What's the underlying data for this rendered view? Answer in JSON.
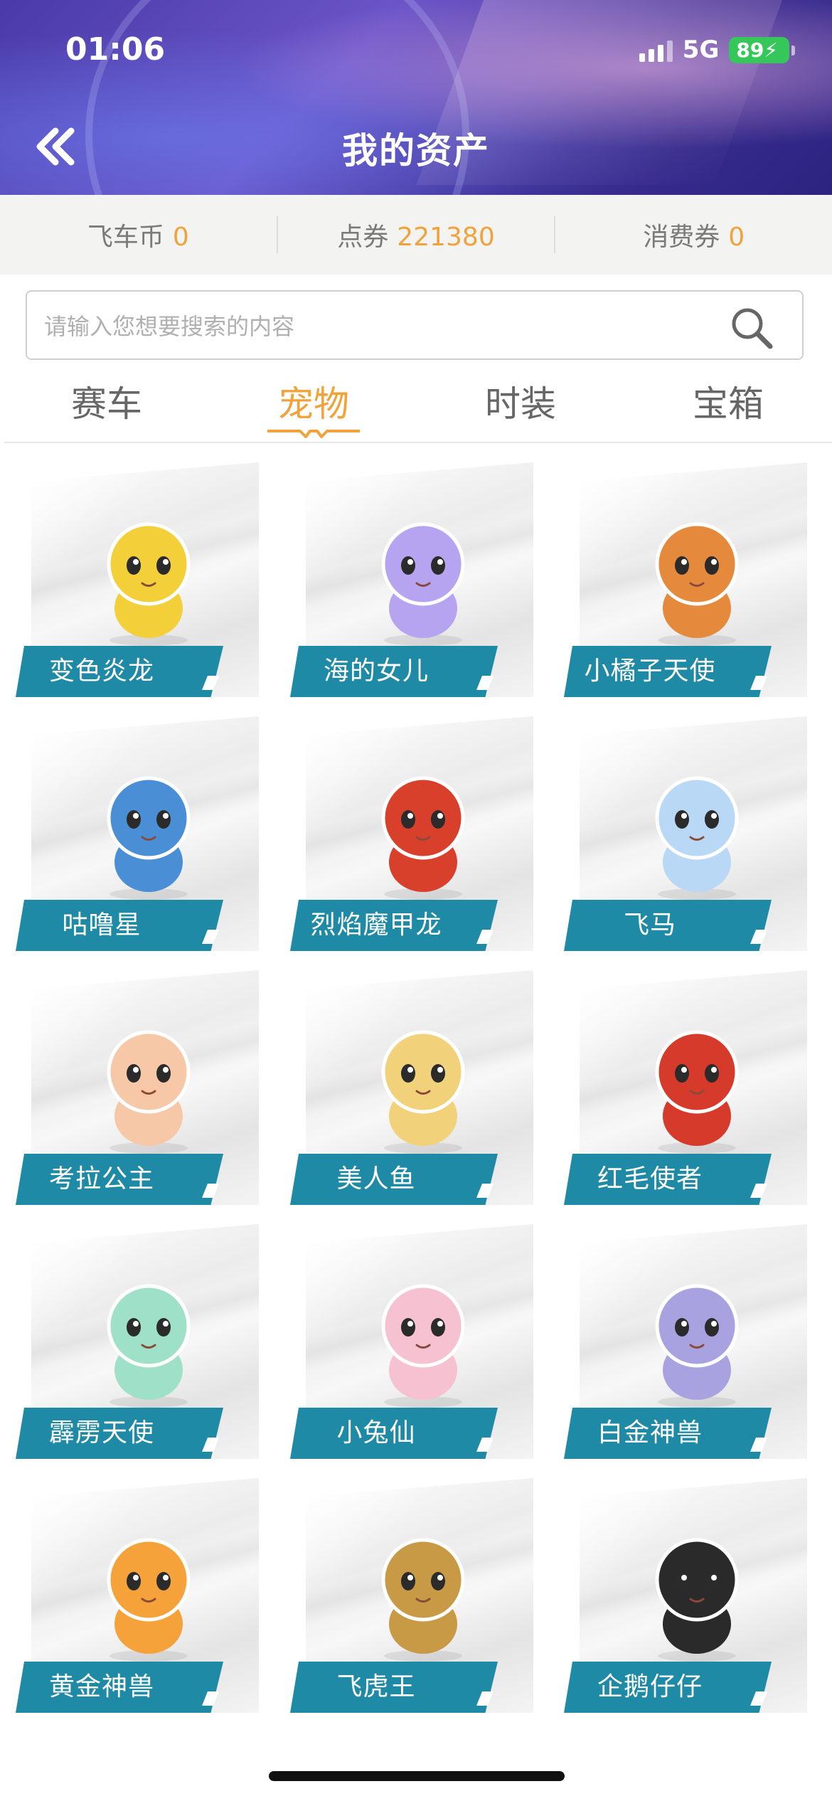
{
  "status": {
    "time": "01:06",
    "network": "5G",
    "battery": "89"
  },
  "header": {
    "title": "我的资产"
  },
  "currency": [
    {
      "label": "飞车币",
      "value": "0"
    },
    {
      "label": "点券",
      "value": "221380"
    },
    {
      "label": "消费券",
      "value": "0"
    }
  ],
  "search": {
    "placeholder": "请输入您想要搜索的内容"
  },
  "tabs": [
    {
      "label": "赛车",
      "active": false
    },
    {
      "label": "宠物",
      "active": true
    },
    {
      "label": "时装",
      "active": false
    },
    {
      "label": "宝箱",
      "active": false
    }
  ],
  "pets": [
    {
      "name": "变色炎龙",
      "color": "#f3d03a"
    },
    {
      "name": "海的女儿",
      "color": "#b7a4f0"
    },
    {
      "name": "小橘子天使",
      "color": "#e58a3d"
    },
    {
      "name": "咕噜星",
      "color": "#4a8fd6"
    },
    {
      "name": "烈焰魔甲龙",
      "color": "#d9402c"
    },
    {
      "name": "飞马",
      "color": "#b8d8f5"
    },
    {
      "name": "考拉公主",
      "color": "#f7c8a8"
    },
    {
      "name": "美人鱼",
      "color": "#f1d27a"
    },
    {
      "name": "红毛使者",
      "color": "#d63a2a"
    },
    {
      "name": "霹雳天使",
      "color": "#9ee0c8"
    },
    {
      "name": "小兔仙",
      "color": "#f6c2d2"
    },
    {
      "name": "白金神兽",
      "color": "#a8a2e0"
    },
    {
      "name": "黄金神兽",
      "color": "#f5a23a"
    },
    {
      "name": "飞虎王",
      "color": "#c89a45"
    },
    {
      "name": "企鹅仔仔",
      "color": "#2a2a2a"
    }
  ]
}
